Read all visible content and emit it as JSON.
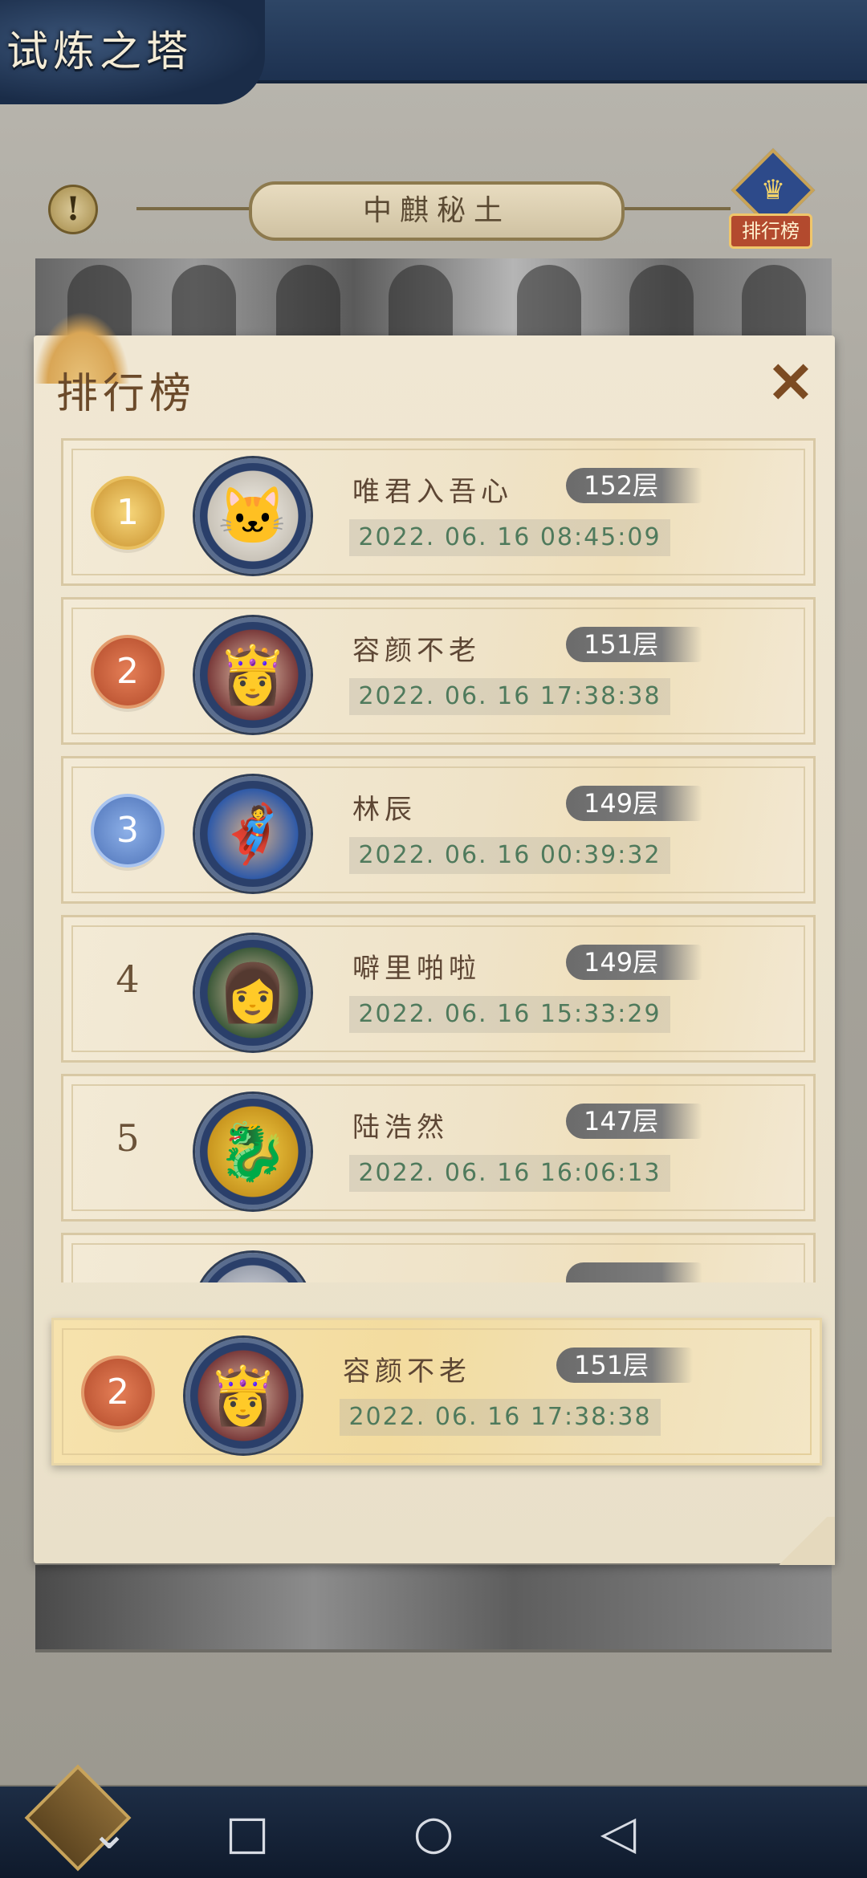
{
  "header": {
    "title": "试炼之塔"
  },
  "map": {
    "name": "中麒秘土",
    "info_icon": "exclamation-icon"
  },
  "rank_button": {
    "label": "排行榜",
    "icon": "ranking-shield-icon"
  },
  "panel": {
    "title": "排行榜",
    "close_icon": "close-x-icon"
  },
  "rankings": [
    {
      "rank": "1",
      "name": "唯君入吾心",
      "floor": "152层",
      "time": "2022. 06. 16 08:45:09",
      "avatar": "white-cat-avatar"
    },
    {
      "rank": "2",
      "name": "容颜不老",
      "floor": "151层",
      "time": "2022. 06. 16 17:38:38",
      "avatar": "crowned-woman-avatar"
    },
    {
      "rank": "3",
      "name": "林辰",
      "floor": "149层",
      "time": "2022. 06. 16 00:39:32",
      "avatar": "superhero-man-avatar"
    },
    {
      "rank": "4",
      "name": "噼里啪啦",
      "floor": "149层",
      "time": "2022. 06. 16 15:33:29",
      "avatar": "flower-woman-avatar"
    },
    {
      "rank": "5",
      "name": "陆浩然",
      "floor": "147层",
      "time": "2022. 06. 16 16:06:13",
      "avatar": "golden-dragon-avatar"
    },
    {
      "rank": "",
      "name": "",
      "floor": "",
      "time": "",
      "avatar": "silver-hair-avatar"
    }
  ],
  "my_rank": {
    "rank": "2",
    "name": "容颜不老",
    "floor": "151层",
    "time": "2022. 06. 16 17:38:38",
    "avatar": "crowned-woman-avatar"
  },
  "navbar": {
    "back_icon": "chevron-down-icon",
    "recents_icon": "square-icon",
    "home_icon": "circle-icon",
    "back_nav_icon": "triangle-back-icon"
  }
}
